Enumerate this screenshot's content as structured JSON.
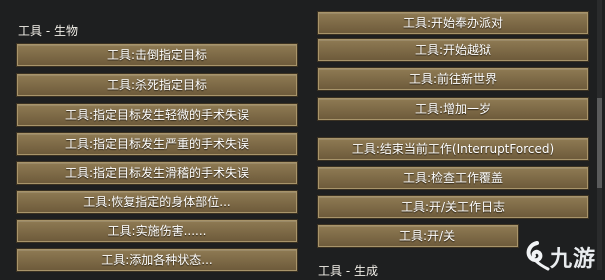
{
  "left_section": {
    "title": "工具 - 生物",
    "buttons": [
      "工具:击倒指定目标",
      "工具:杀死指定目标",
      "工具:指定目标发生轻微的手术失误",
      "工具:指定目标发生严重的手术失误",
      "工具:指定目标发生滑稽的手术失误",
      "工具:恢复指定的身体部位...",
      "工具:实施伤害......",
      "工具:添加各种状态..."
    ]
  },
  "right_section": {
    "title": "工具 - 生成",
    "buttons": [
      "工具:开始奉办派对",
      "工具:开始越狱",
      "工具:前往新世界",
      "工具:增加一岁",
      "工具:结束当前工作(InterruptForced)",
      "工具:检查工作覆盖",
      "工具:开/关工作日志",
      "工具:开/关"
    ]
  },
  "watermark": {
    "text": "九游"
  }
}
